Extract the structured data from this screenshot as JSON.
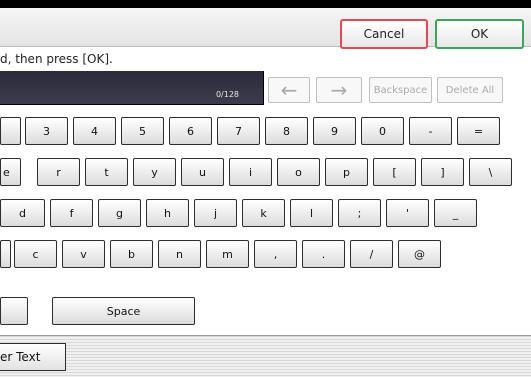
{
  "header": {
    "cancel_label": "Cancel",
    "ok_label": "OK"
  },
  "instruction": "d, then press [OK].",
  "text_field": {
    "counter": "0/128"
  },
  "nav": {
    "left_arrow": "←",
    "right_arrow": "→",
    "backspace_label": "Backspace",
    "delete_all_label": "Delete All"
  },
  "keys": {
    "row1": [
      "",
      "3",
      "4",
      "5",
      "6",
      "7",
      "8",
      "9",
      "0",
      "-",
      "="
    ],
    "row2": [
      "e",
      "r",
      "t",
      "y",
      "u",
      "i",
      "o",
      "p",
      "[",
      "]",
      "\\"
    ],
    "row3": [
      "d",
      "f",
      "g",
      "h",
      "j",
      "k",
      "l",
      ";",
      "'",
      "_"
    ],
    "row4": [
      "",
      "c",
      "v",
      "b",
      "n",
      "m",
      ",",
      ".",
      "/",
      "@"
    ],
    "row5_left": "",
    "space_label": "Space"
  },
  "footer": {
    "tab_label": "er Text"
  }
}
